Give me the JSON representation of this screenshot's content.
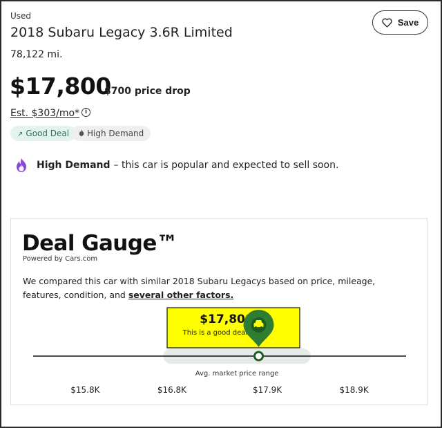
{
  "listing": {
    "condition": "Used",
    "title": "2018 Subaru Legacy 3.6R Limited",
    "mileage": "78,122 mi.",
    "price": "$17,800",
    "price_drop": "$700 price drop",
    "monthly_estimate": "Est. $303/mo*",
    "info_icon": "info-icon"
  },
  "badges": {
    "good_deal": {
      "label": "Good Deal",
      "icon": "arrow-up-right-icon"
    },
    "high_demand": {
      "label": "High Demand",
      "icon": "flame-icon"
    }
  },
  "demand_notice": {
    "label": "High Demand",
    "text": "– this car is popular and expected to sell soon.",
    "icon": "flame-icon",
    "icon_color": "#8a4ad6"
  },
  "save": {
    "label": "Save",
    "icon": "heart-icon"
  },
  "deal_gauge": {
    "title": "Deal Gauge™",
    "powered_by": "Powered by Cars.com",
    "description_prefix": "We compared this car with similar 2018 Subaru Legacys based on price, mileage, features, condition, and ",
    "description_link": "several other factors.",
    "callout_price": "$17,800",
    "callout_subtitle": "This is a good deal.",
    "range_label": "Avg. market price range",
    "marker_icon": "car-icon",
    "colors": {
      "callout_bg": "#ffff00",
      "marker": "#2e7d32",
      "range_band": "#e6ebe8"
    }
  },
  "chart_data": {
    "type": "gauge",
    "ticks": [
      "$15.8K",
      "$16.8K",
      "$17.9K",
      "$18.9K"
    ],
    "tick_values": [
      15800,
      16800,
      17900,
      18900
    ],
    "axis_range": [
      15200,
      19500
    ],
    "listing_price": 17800,
    "avg_market_range": [
      16700,
      18400
    ]
  }
}
